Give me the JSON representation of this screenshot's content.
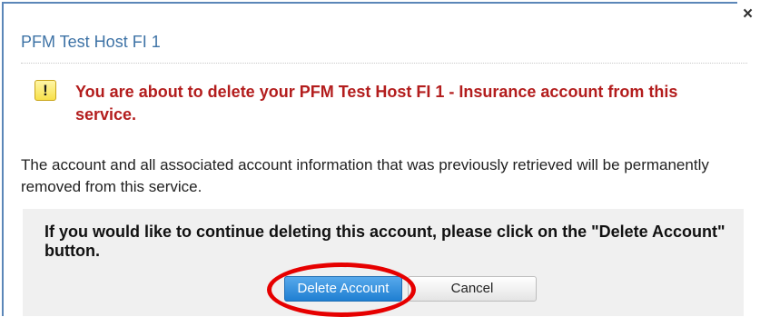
{
  "dialog": {
    "title": "PFM Test Host FI 1",
    "close_label": "×",
    "warning_icon_glyph": "!",
    "warning_text": "You are about to delete your PFM Test Host FI 1 - Insurance account from this service.",
    "info_text": "The account and all associated account information that was previously retrieved will be permanently removed from this service.",
    "confirm_text": "If you would like to continue deleting this account, please click on the \"Delete Account\" button.",
    "buttons": {
      "delete_label": "Delete Account",
      "cancel_label": "Cancel"
    }
  },
  "colors": {
    "title": "#3e73a6",
    "warning_text": "#b31d1d",
    "delete_button": "#2c8ee0",
    "highlight_ellipse": "#e60000",
    "border": "#5b86b8"
  },
  "icons": {
    "close": "close-icon",
    "warning": "warning-icon"
  }
}
